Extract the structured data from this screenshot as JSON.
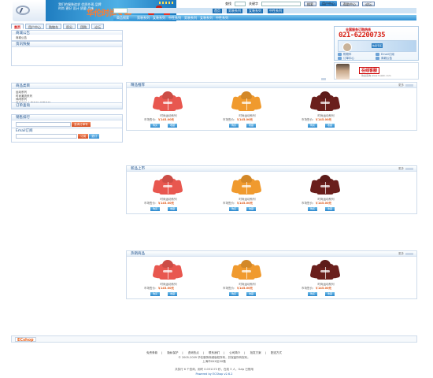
{
  "brand": {
    "logo_text": "HUALIN",
    "name_a": "华伦",
    "name_b": "时尚女装",
    "slogan": "我们的服装追求 优质外观 品牌 时尚 更好 设计 质量 品味"
  },
  "toplinks": {
    "search_label": "查找",
    "keyword_label": "关键字",
    "search_btn": "搜索",
    "user_center": "用户中心",
    "help": "帮助中心",
    "forum": "论坛"
  },
  "nav": {
    "current": "首页",
    "links": [
      "男装系列",
      "女装系列",
      "中性系列"
    ]
  },
  "catbar": {
    "first": "商品搜索",
    "links": [
      "男装系列",
      "女装系列",
      "中性系列",
      "男装系列",
      "女装系列",
      "中性系列"
    ],
    "search_label": "所有商品"
  },
  "tabs": [
    "首页",
    "用户中心",
    "购物车",
    "积分",
    "团购",
    "论坛"
  ],
  "left": {
    "notice": {
      "title": "商城公告",
      "text": "商城公告"
    },
    "news": {
      "title": "资讯快报"
    },
    "category": {
      "title": "商品类目",
      "items": [
        "运动系列",
        "时尚潮流系列",
        "休闲系列",
        "男装系列 女装系列 中性系列",
        "女装系列"
      ]
    },
    "order": {
      "title": "订单查询"
    },
    "top": {
      "title": "销售排行",
      "btn": "查询订单号"
    },
    "email": {
      "title": "Email订阅",
      "sub": "订阅",
      "unsub": "退订"
    }
  },
  "hotline": {
    "title": "全国服务订购热线",
    "number": "021-62200735",
    "promo": "热卖专区",
    "items": [
      "购物车",
      "订单中心",
      "Email订阅",
      "商城公告"
    ]
  },
  "online": {
    "label": "在线客服",
    "sub": "欢迎咨询 www.hualin.com"
  },
  "sections": [
    {
      "title": "精品推荐",
      "more": "更多"
    },
    {
      "title": "新品上市",
      "more": "更多"
    },
    {
      "title": "热销商品",
      "more": "更多"
    }
  ],
  "product": {
    "name": "时尚运动系列",
    "price_label": "市场售价：",
    "price": "￥145.00元",
    "buy": "购买",
    "collect": "收藏"
  },
  "product_colors": [
    "#e8574f",
    "#f09a2e",
    "#6a1f1c"
  ],
  "footer": {
    "ecshop": "ECshop",
    "links": [
      "免责条款",
      "隐私保护",
      "咨询热点",
      "联系我们",
      "公司简介",
      "批发方案",
      "配送方式"
    ],
    "copyright": "© 2005-2009 华伦服饰商城版权所有，并保留所有权利。",
    "address": "上海市XXX区XX路",
    "stats": "共执行 6 个查询，用时 0.031172 秒，在线 3 人，Gzip 已禁用",
    "powered": "Powered by ECShop v2.6.2"
  },
  "colors": {
    "accent": "#2e8fd3",
    "price": "#e05a1a",
    "hotline": "#d8261b"
  }
}
